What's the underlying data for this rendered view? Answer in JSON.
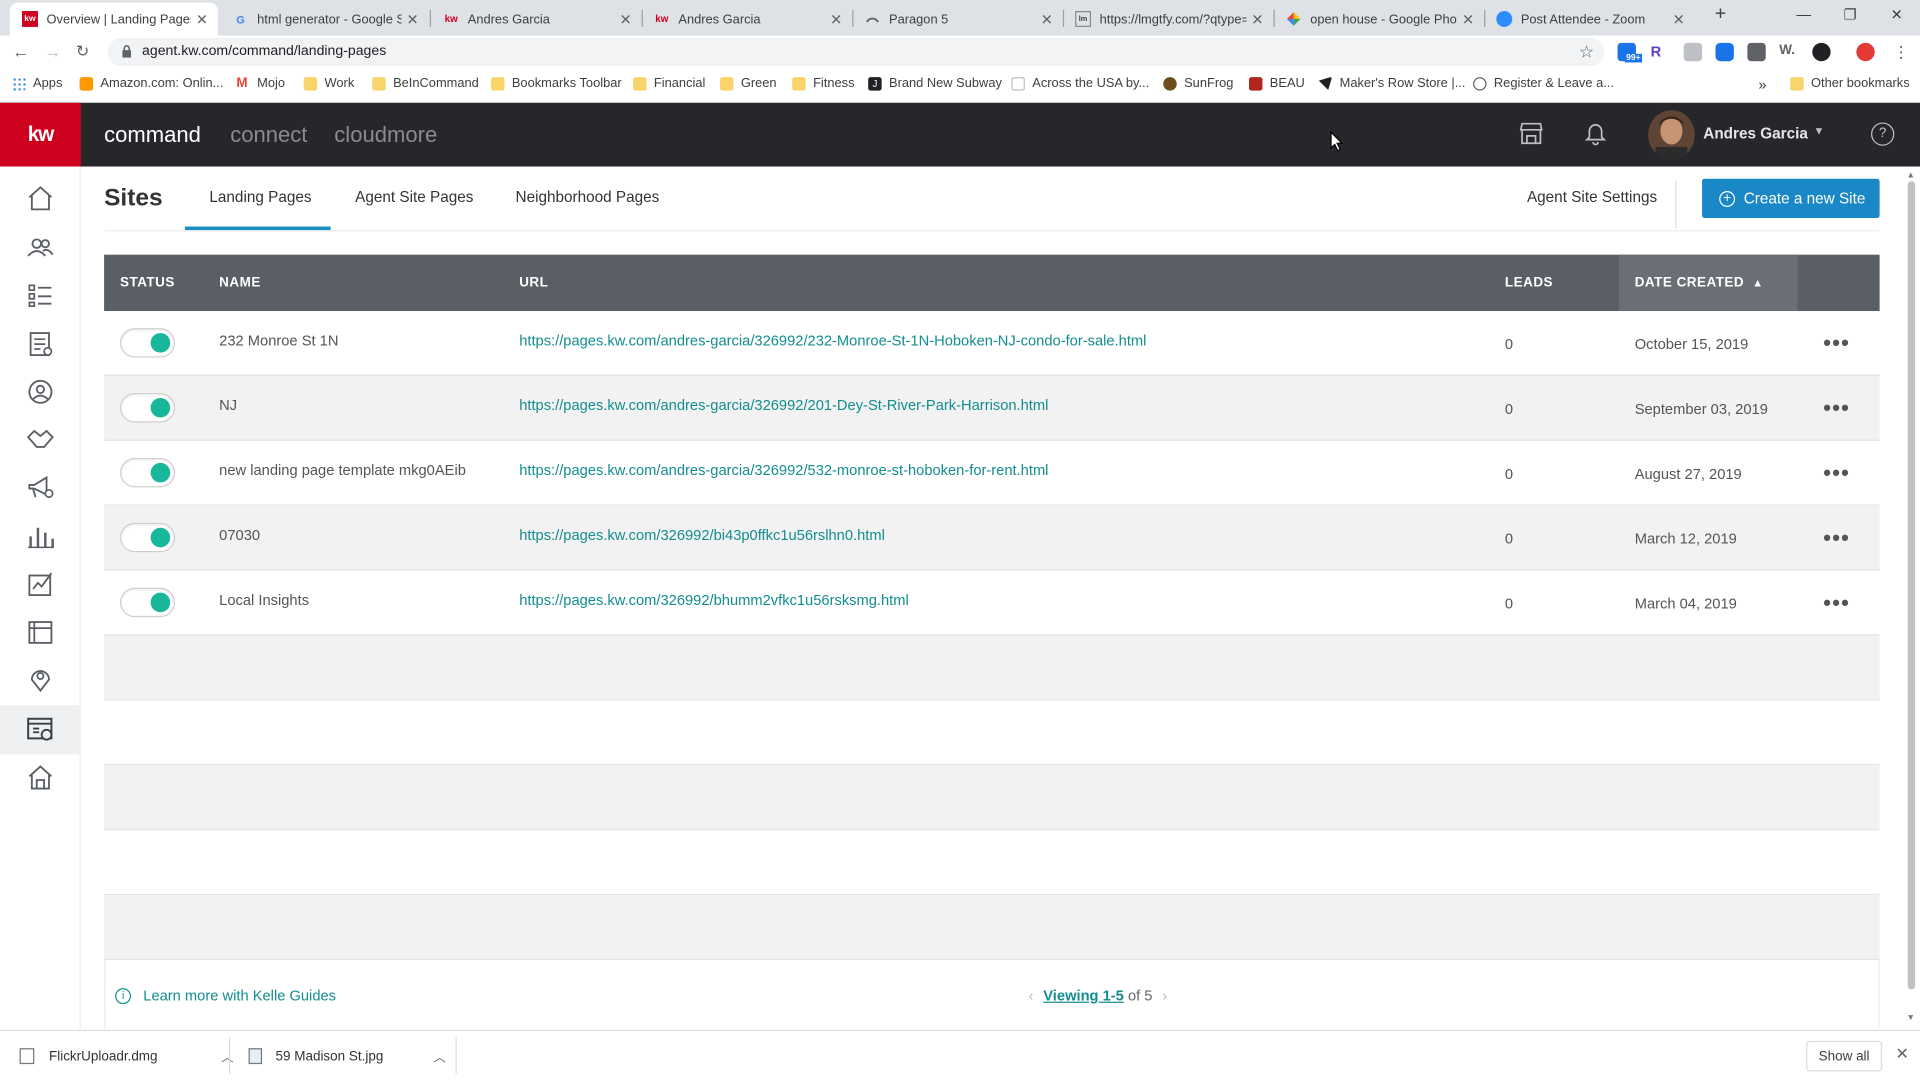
{
  "browser": {
    "tabs": [
      {
        "title": "Overview | Landing Pages",
        "icon": "kw-favicon"
      },
      {
        "title": "html generator - Google Se",
        "icon": "google-favicon"
      },
      {
        "title": "Andres Garcia",
        "icon": "kw-favicon"
      },
      {
        "title": "Andres Garcia",
        "icon": "kw-favicon"
      },
      {
        "title": "Paragon 5",
        "icon": "paragon-favicon"
      },
      {
        "title": "https://lmgtfy.com/?qtype=",
        "icon": "lmgtfy-favicon"
      },
      {
        "title": "open house - Google Photo",
        "icon": "photos-favicon"
      },
      {
        "title": "Post Attendee - Zoom",
        "icon": "zoom-favicon"
      }
    ],
    "url": "agent.kw.com/command/landing-pages",
    "bookmarks": [
      {
        "label": "Apps",
        "icon": "apps-grid-icon"
      },
      {
        "label": "Amazon.com: Onlin...",
        "icon": "amazon-favicon"
      },
      {
        "label": "Mojo",
        "icon": "gmail-favicon"
      },
      {
        "label": "Work",
        "icon": "folder-icon"
      },
      {
        "label": "BeInCommand",
        "icon": "folder-icon"
      },
      {
        "label": "Bookmarks Toolbar",
        "icon": "folder-icon"
      },
      {
        "label": "Financial",
        "icon": "folder-icon"
      },
      {
        "label": "Green",
        "icon": "folder-icon"
      },
      {
        "label": "Fitness",
        "icon": "folder-icon"
      },
      {
        "label": "Brand New Subway",
        "icon": "j-favicon"
      },
      {
        "label": "Across the USA by...",
        "icon": "page-favicon"
      },
      {
        "label": "SunFrog",
        "icon": "sunfrog-favicon"
      },
      {
        "label": "BEAU",
        "icon": "beau-favicon"
      },
      {
        "label": "Maker's Row Store |...",
        "icon": "makers-favicon"
      },
      {
        "label": "Register & Leave a...",
        "icon": "globe-favicon"
      }
    ],
    "other_bookmarks": "Other bookmarks",
    "bookmarks_overflow": "»",
    "extension_badge": "99+"
  },
  "app": {
    "logo": "kw",
    "nav": [
      "command",
      "connect",
      "cloudmore"
    ],
    "user_name": "Andres Garcia"
  },
  "page": {
    "title": "Sites",
    "tabs": [
      "Landing Pages",
      "Agent Site Pages",
      "Neighborhood Pages"
    ],
    "active_tab": "Landing Pages",
    "settings_link": "Agent Site Settings",
    "create_button": "Create a new Site"
  },
  "table": {
    "columns": [
      "STATUS",
      "NAME",
      "URL",
      "LEADS",
      "DATE CREATED"
    ],
    "sort_column": "DATE CREATED",
    "sort_direction": "ascending-arrow",
    "rows": [
      {
        "enabled": true,
        "name": "232 Monroe St 1N",
        "url": "https://pages.kw.com/andres-garcia/326992/232-Monroe-St-1N-Hoboken-NJ-condo-for-sale.html",
        "leads": "0",
        "date": "October 15, 2019"
      },
      {
        "enabled": true,
        "name": "NJ",
        "url": "https://pages.kw.com/andres-garcia/326992/201-Dey-St-River-Park-Harrison.html",
        "leads": "0",
        "date": "September 03, 2019"
      },
      {
        "enabled": true,
        "name": "new landing page template mkg0AEib",
        "url": "https://pages.kw.com/andres-garcia/326992/532-monroe-st-hoboken-for-rent.html",
        "leads": "0",
        "date": "August 27, 2019"
      },
      {
        "enabled": true,
        "name": "07030",
        "url": "https://pages.kw.com/326992/bi43p0ffkc1u56rslhn0.html",
        "leads": "0",
        "date": "March 12, 2019"
      },
      {
        "enabled": true,
        "name": "Local Insights",
        "url": "https://pages.kw.com/326992/bhumm2vfkc1u56rsksmg.html",
        "leads": "0",
        "date": "March 04, 2019"
      }
    ],
    "row_menu": "•••"
  },
  "footer": {
    "learn_more": "Learn more with Kelle Guides",
    "viewing": "Viewing 1-5",
    "of_total": "of 5"
  },
  "downloads": [
    {
      "name": "FlickrUploadr.dmg"
    },
    {
      "name": "59 Madison St.jpg"
    }
  ],
  "show_all": "Show all",
  "colors": {
    "brand_red": "#ce011f",
    "accent_blue": "#1a87c7",
    "teal": "#18b69b",
    "link": "#138d8f"
  }
}
